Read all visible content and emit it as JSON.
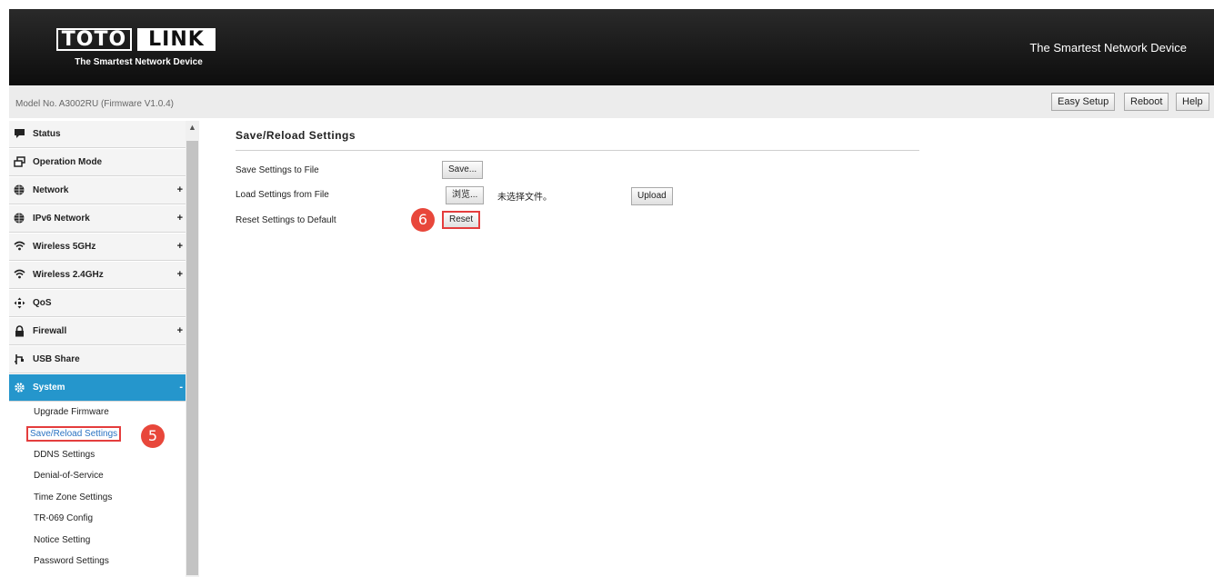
{
  "header": {
    "logo_part1": "TOTO",
    "logo_part2": "LINK",
    "logo_tagline": "The Smartest Network Device",
    "slogan": "The Smartest Network Device"
  },
  "model_bar": {
    "model_text": "Model No. A3002RU (Firmware V1.0.4)",
    "easy_setup": "Easy Setup",
    "reboot": "Reboot",
    "help": "Help"
  },
  "sidebar": {
    "items": [
      {
        "label": "Status",
        "icon": "chat-icon"
      },
      {
        "label": "Operation Mode",
        "icon": "windows-icon"
      },
      {
        "label": "Network",
        "icon": "globe-icon",
        "expand": "+"
      },
      {
        "label": "IPv6 Network",
        "icon": "globe-icon",
        "expand": "+"
      },
      {
        "label": "Wireless 5GHz",
        "icon": "wifi-icon",
        "expand": "+"
      },
      {
        "label": "Wireless 2.4GHz",
        "icon": "wifi-icon",
        "expand": "+"
      },
      {
        "label": "QoS",
        "icon": "qos-icon"
      },
      {
        "label": "Firewall",
        "icon": "lock-icon",
        "expand": "+"
      },
      {
        "label": "USB Share",
        "icon": "usb-icon"
      },
      {
        "label": "System",
        "icon": "gear-icon",
        "expand": "-"
      }
    ],
    "subitems": [
      {
        "label": "Upgrade Firmware"
      },
      {
        "label": "Save/Reload Settings"
      },
      {
        "label": "DDNS Settings"
      },
      {
        "label": "Denial-of-Service"
      },
      {
        "label": "Time Zone Settings"
      },
      {
        "label": "TR-069 Config"
      },
      {
        "label": "Notice Setting"
      },
      {
        "label": "Password Settings"
      }
    ]
  },
  "content": {
    "title": "Save/Reload Settings",
    "save_label": "Save Settings to File",
    "save_button": "Save...",
    "load_label": "Load Settings from File",
    "browse_button": "浏览...",
    "file_status": "未选择文件。",
    "upload_button": "Upload",
    "reset_label": "Reset Settings to Default",
    "reset_button": "Reset"
  },
  "annotations": {
    "step5": "5",
    "step6": "6"
  },
  "colors": {
    "active_menu": "#2596cc",
    "highlight_border": "#e43d3d",
    "badge": "#e8473b"
  }
}
